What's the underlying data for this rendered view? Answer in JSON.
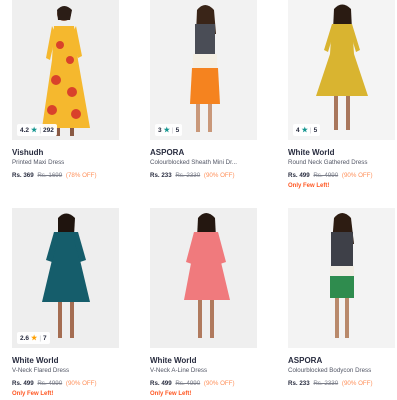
{
  "colors": {
    "brand_text": "#282c3f",
    "discount": "#ff905a",
    "few_left": "#ff5722",
    "star_teal": "#14958f",
    "star_gold": "#ff9f00"
  },
  "products": [
    {
      "brand": "Vishudh",
      "name": "Printed Maxi Dress",
      "price": "Rs. 369",
      "mrp": "Rs. 1699",
      "discount": "(78% OFF)",
      "few_left": "",
      "rating": {
        "score": "4.2",
        "count": "292",
        "star_icon": "star-icon-teal"
      }
    },
    {
      "brand": "ASPORA",
      "name": "Colourblocked Sheath Mini Dr...",
      "price": "Rs. 233",
      "mrp": "Rs. 2330",
      "discount": "(90% OFF)",
      "few_left": "",
      "rating": {
        "score": "3",
        "count": "5",
        "star_icon": "star-icon-teal"
      }
    },
    {
      "brand": "White World",
      "name": "Round Neck Gathered Dress",
      "price": "Rs. 499",
      "mrp": "Rs. 4990",
      "discount": "(90% OFF)",
      "few_left": "Only Few Left!",
      "rating": {
        "score": "4",
        "count": "5",
        "star_icon": "star-icon-teal"
      }
    },
    {
      "brand": "White World",
      "name": "V-Neck Flared Dress",
      "price": "Rs. 499",
      "mrp": "Rs. 4990",
      "discount": "(90% OFF)",
      "few_left": "Only Few Left!",
      "rating": {
        "score": "2.6",
        "count": "7",
        "star_icon": "star-icon-gold"
      }
    },
    {
      "brand": "White World",
      "name": "V-Neck A-Line Dress",
      "price": "Rs. 499",
      "mrp": "Rs. 4990",
      "discount": "(90% OFF)",
      "few_left": "Only Few Left!",
      "rating": null
    },
    {
      "brand": "ASPORA",
      "name": "Colourblocked Bodycon Dress",
      "price": "Rs. 233",
      "mrp": "Rs. 2330",
      "discount": "(90% OFF)",
      "few_left": "",
      "rating": null
    }
  ]
}
